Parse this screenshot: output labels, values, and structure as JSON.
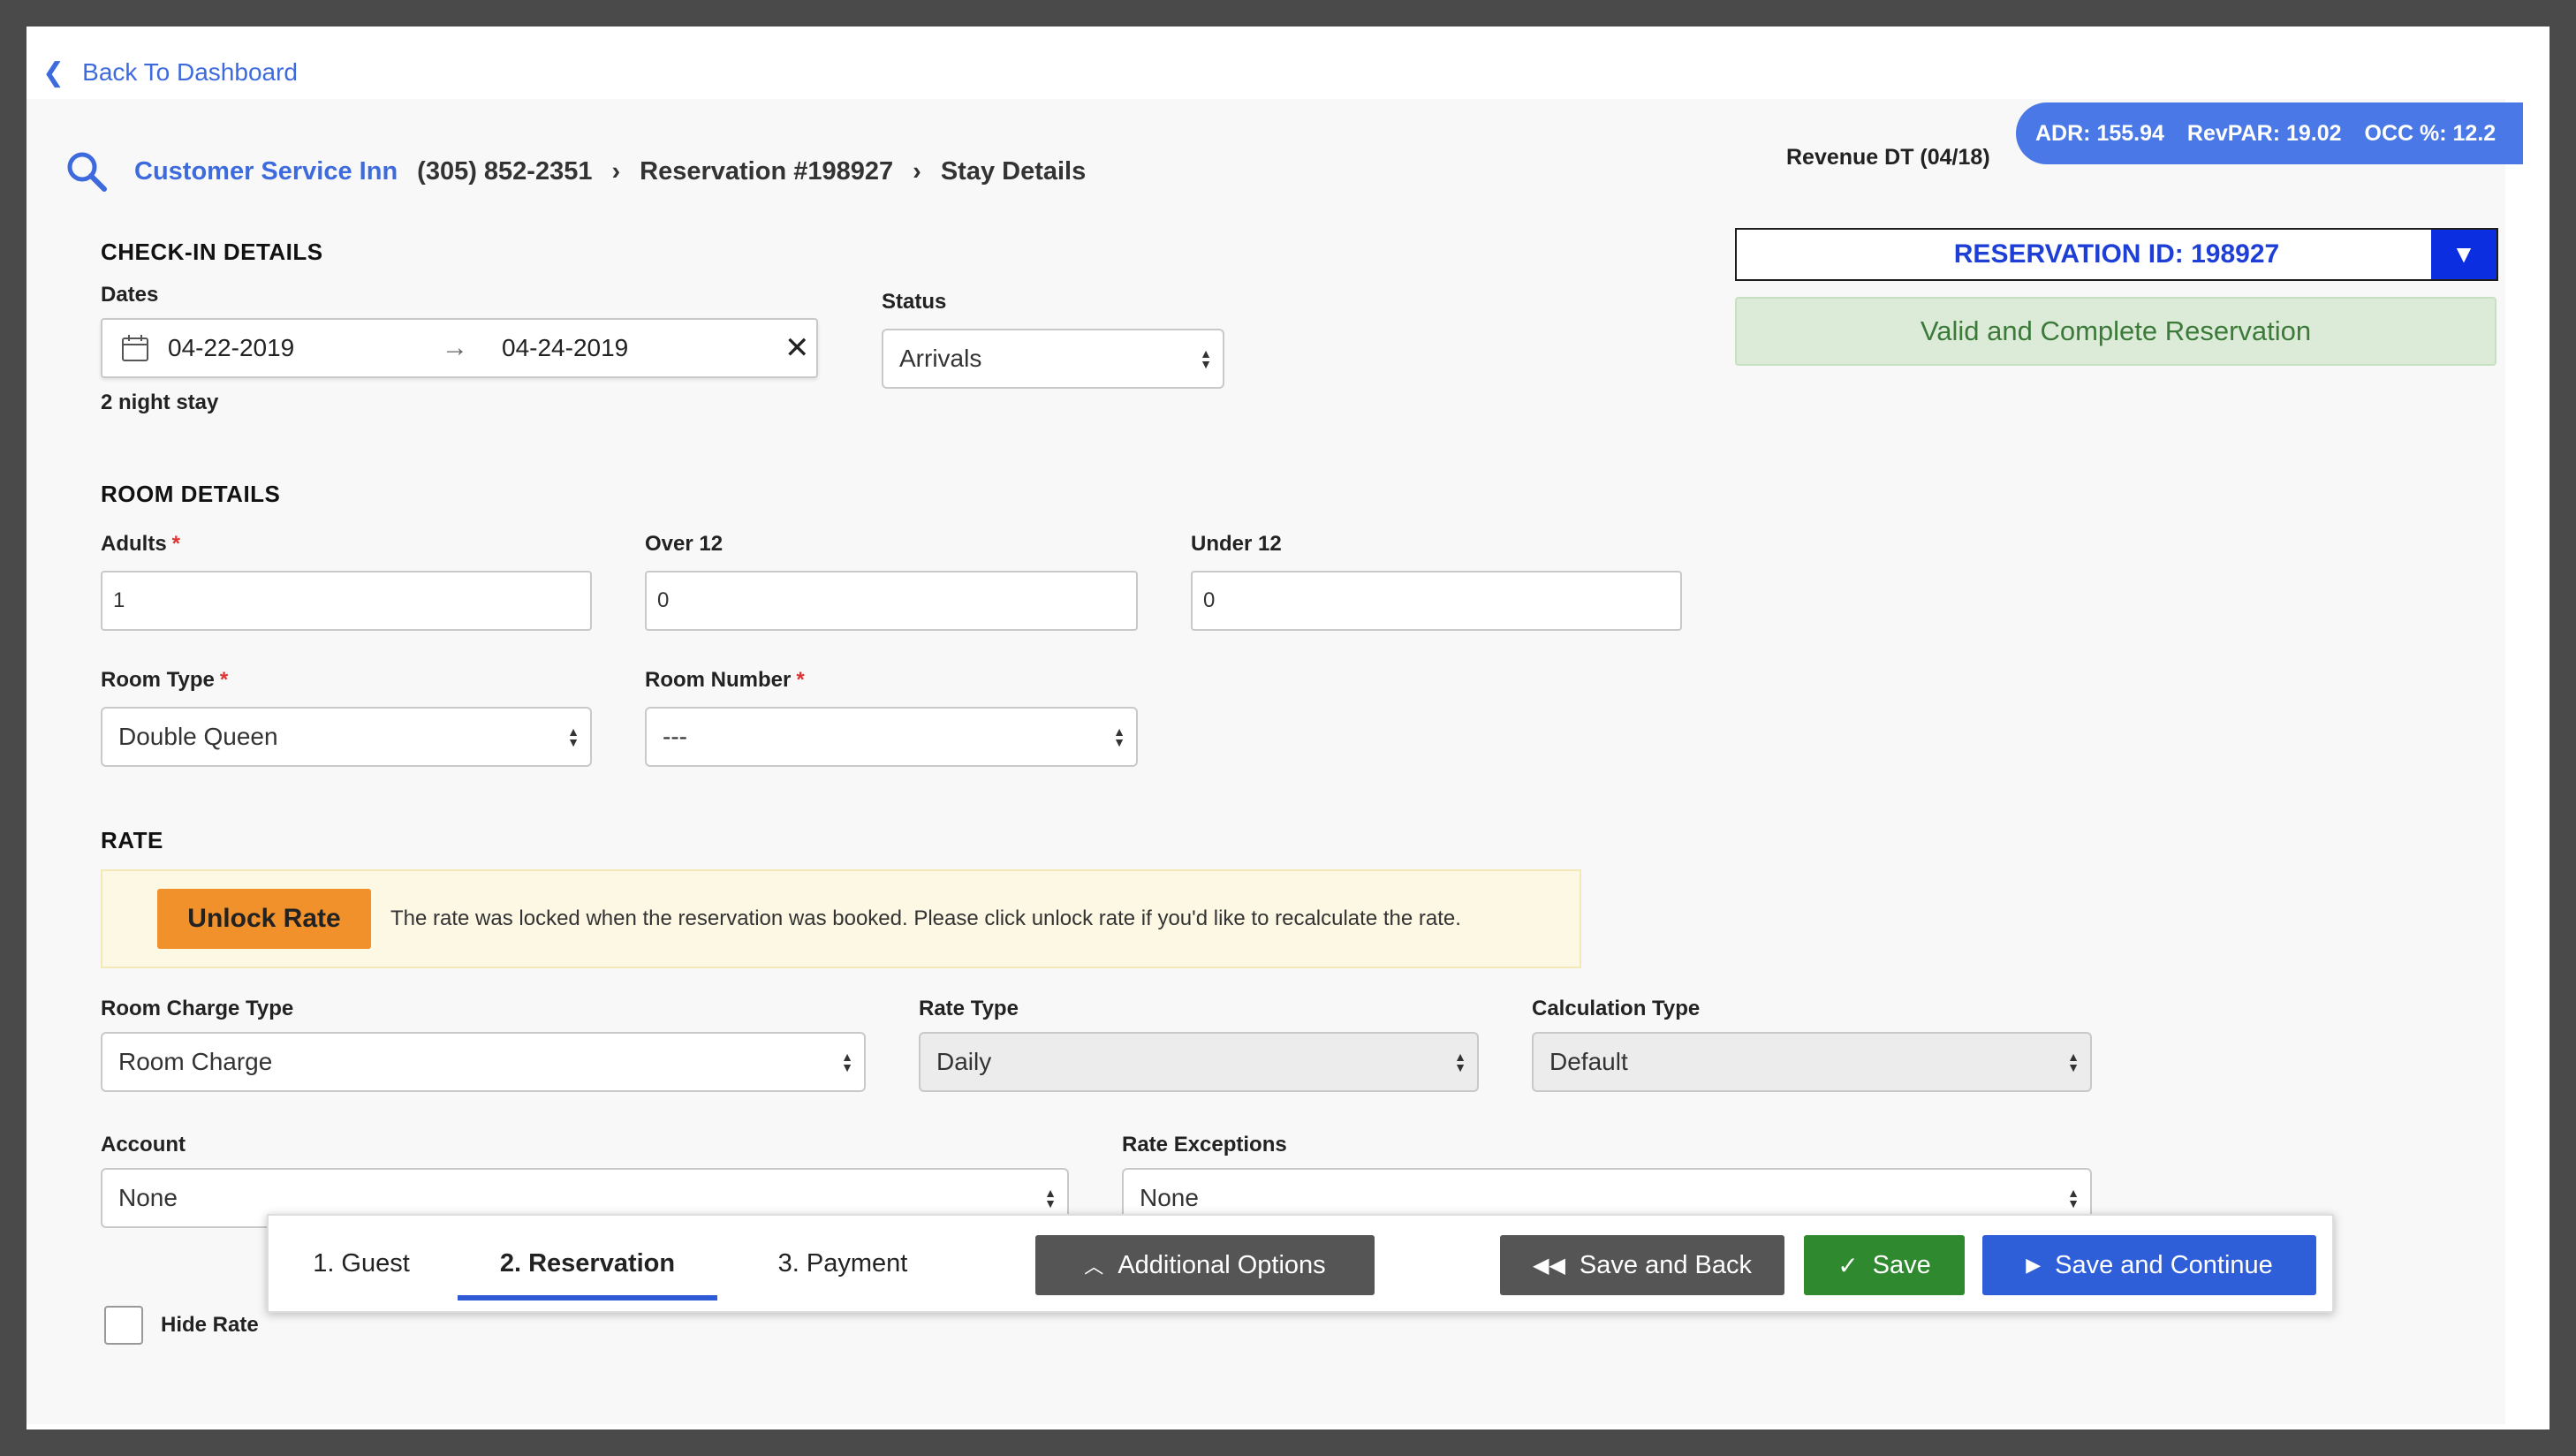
{
  "nav": {
    "back_label": "Back To Dashboard"
  },
  "breadcrumb": {
    "inn": "Customer Service Inn",
    "phone": "(305) 852-2351",
    "reservation": "Reservation #198927",
    "page": "Stay Details"
  },
  "revenue": {
    "label": "Revenue DT (04/18)",
    "adr": "ADR: 155.94",
    "revpar": "RevPAR: 19.02",
    "occ": "OCC %: 12.2"
  },
  "checkin": {
    "title": "CHECK-IN DETAILS",
    "dates_label": "Dates",
    "start_date": "04-22-2019",
    "end_date": "04-24-2019",
    "stay_length": "2 night stay",
    "status_label": "Status",
    "status_value": "Arrivals"
  },
  "reservation_panel": {
    "id_label": "RESERVATION ID: 198927",
    "validity": "Valid and Complete Reservation"
  },
  "room": {
    "title": "ROOM DETAILS",
    "adults_label": "Adults",
    "adults_value": "1",
    "over12_label": "Over 12",
    "over12_value": "0",
    "under12_label": "Under 12",
    "under12_value": "0",
    "room_type_label": "Room Type",
    "room_type_value": "Double Queen",
    "room_number_label": "Room Number",
    "room_number_value": "---",
    "required_mark": "*"
  },
  "rate": {
    "title": "RATE",
    "unlock_label": "Unlock Rate",
    "notice": "The rate was locked when the reservation was booked. Please click unlock rate if you'd like to recalculate the rate.",
    "charge_type_label": "Room Charge Type",
    "charge_type_value": "Room Charge",
    "rate_type_label": "Rate Type",
    "rate_type_value": "Daily",
    "calc_type_label": "Calculation Type",
    "calc_type_value": "Default",
    "account_label": "Account",
    "account_value": "None",
    "exceptions_label": "Rate Exceptions",
    "exceptions_value": "None",
    "hide_rate_label": "Hide Rate"
  },
  "toolbar": {
    "tabs": [
      "1. Guest",
      "2. Reservation",
      "3. Payment"
    ],
    "additional_options": "Additional Options",
    "save_back": "Save and Back",
    "save": "Save",
    "save_continue": "Save and Continue"
  },
  "colors": {
    "link_blue": "#3d6bdd",
    "kpi_blue": "#4a78e6",
    "unlock_orange": "#f0912c",
    "save_green": "#2f8a2f",
    "continue_blue": "#2e5fd8"
  }
}
